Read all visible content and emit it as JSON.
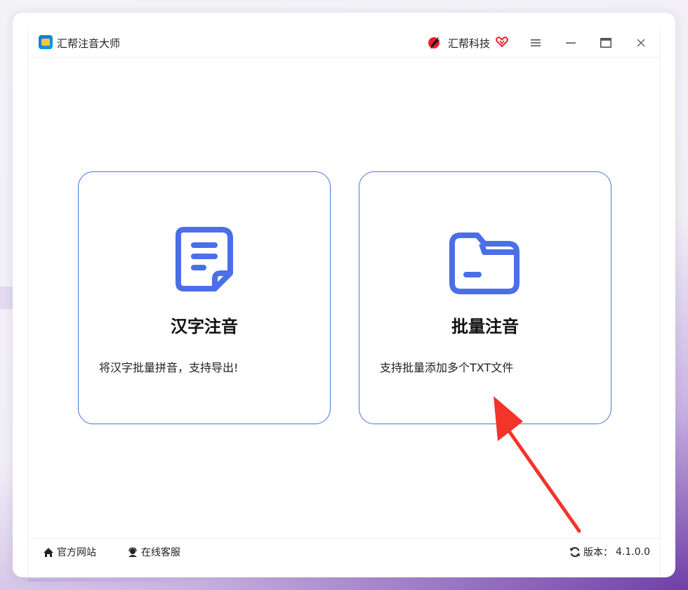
{
  "titlebar": {
    "app_title": "汇帮注音大师",
    "brand_name": "汇帮科技",
    "icons": [
      "app-logo-icon",
      "brand-logo-icon",
      "vip-heart-icon",
      "menu-icon",
      "minimize-icon",
      "maximize-icon",
      "close-icon"
    ]
  },
  "cards": [
    {
      "title": "汉字注音",
      "description": "将汉字批量拼音，支持导出!",
      "icon": "document-icon"
    },
    {
      "title": "批量注音",
      "description": "支持批量添加多个TXT文件",
      "icon": "folder-icon"
    }
  ],
  "footer": {
    "website_label": "官方网站",
    "service_label": "在线客服",
    "version_label": "版本：",
    "version_value": "4.1.0.0"
  },
  "colors": {
    "accent": "#4b74e0",
    "annotation_arrow": "#f2342a",
    "brand_red": "#e8202a"
  }
}
